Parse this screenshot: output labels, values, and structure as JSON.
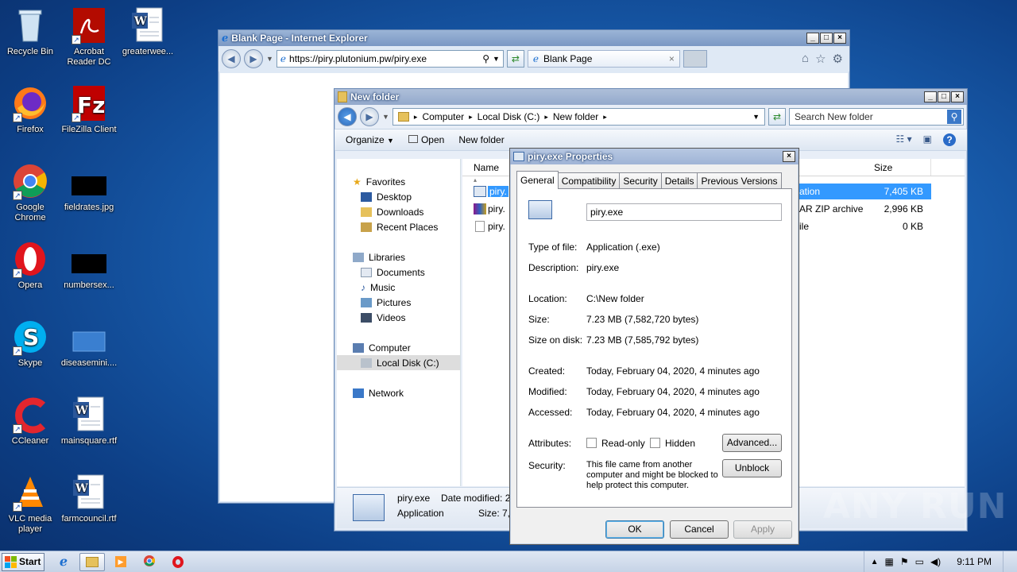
{
  "desktop": {
    "icons": [
      {
        "label": "Recycle Bin",
        "icon": "recycle-bin-icon"
      },
      {
        "label": "Acrobat Reader DC",
        "icon": "acrobat-icon"
      },
      {
        "label": "greaterwee...",
        "icon": "word-doc-icon"
      },
      {
        "label": "Firefox",
        "icon": "firefox-icon"
      },
      {
        "label": "FileZilla Client",
        "icon": "filezilla-icon"
      },
      {
        "label": "Google Chrome",
        "icon": "chrome-icon"
      },
      {
        "label": "fieldrates.jpg",
        "icon": "image-file-icon"
      },
      {
        "label": "Opera",
        "icon": "opera-icon"
      },
      {
        "label": "numbersex...",
        "icon": "image-file-icon"
      },
      {
        "label": "Skype",
        "icon": "skype-icon"
      },
      {
        "label": "diseasemini....",
        "icon": "image-file-icon"
      },
      {
        "label": "CCleaner",
        "icon": "ccleaner-icon"
      },
      {
        "label": "mainsquare.rtf",
        "icon": "word-doc-icon"
      },
      {
        "label": "VLC media player",
        "icon": "vlc-icon"
      },
      {
        "label": "farmcouncil.rtf",
        "icon": "word-doc-icon"
      }
    ]
  },
  "ie": {
    "title": "Blank Page - Internet Explorer",
    "url": "https://piry.plutonium.pw/piry.exe",
    "tab_label": "Blank Page"
  },
  "explorer": {
    "title": "New folder",
    "breadcrumb": [
      "Computer",
      "Local Disk (C:)",
      "New folder"
    ],
    "search_placeholder": "Search New folder",
    "cmd": {
      "organize": "Organize",
      "open": "Open",
      "new_folder": "New folder"
    },
    "nav": {
      "favorites": "Favorites",
      "desktop": "Desktop",
      "downloads": "Downloads",
      "recent": "Recent Places",
      "libraries": "Libraries",
      "documents": "Documents",
      "music": "Music",
      "pictures": "Pictures",
      "videos": "Videos",
      "computer": "Computer",
      "local_disk": "Local Disk (C:)",
      "network": "Network"
    },
    "columns": {
      "name": "Name",
      "size": "Size"
    },
    "files": [
      {
        "name": "piry.",
        "type": "ation",
        "size": "7,405 KB"
      },
      {
        "name": "piry.",
        "type": "AR ZIP archive",
        "size": "2,996 KB"
      },
      {
        "name": "piry.",
        "type": "ile",
        "size": "0 KB"
      }
    ],
    "details": {
      "name": "piry.exe",
      "type": "Application",
      "modified_label": "Date modified: 2/",
      "size_label": "Size: 7,"
    }
  },
  "props": {
    "title": "piry.exe Properties",
    "tabs": [
      "General",
      "Compatibility",
      "Security",
      "Details",
      "Previous Versions"
    ],
    "filename": "piry.exe",
    "type_label": "Type of file:",
    "type_value": "Application (.exe)",
    "desc_label": "Description:",
    "desc_value": "piry.exe",
    "loc_label": "Location:",
    "loc_value": "C:\\New folder",
    "size_label": "Size:",
    "size_value": "7.23 MB (7,582,720 bytes)",
    "disk_label": "Size on disk:",
    "disk_value": "7.23 MB (7,585,792 bytes)",
    "created_label": "Created:",
    "created_value": "Today, February 04, 2020, 4 minutes ago",
    "modified_label": "Modified:",
    "modified_value": "Today, February 04, 2020, 4 minutes ago",
    "accessed_label": "Accessed:",
    "accessed_value": "Today, February 04, 2020, 4 minutes ago",
    "attr_label": "Attributes:",
    "readonly": "Read-only",
    "hidden": "Hidden",
    "advanced": "Advanced...",
    "security_label": "Security:",
    "security_text": "This file came from another computer and might be blocked to help protect this computer.",
    "unblock": "Unblock",
    "ok": "OK",
    "cancel": "Cancel",
    "apply": "Apply"
  },
  "taskbar": {
    "start": "Start",
    "time": "9:11 PM"
  },
  "watermark": "ANY RUN"
}
